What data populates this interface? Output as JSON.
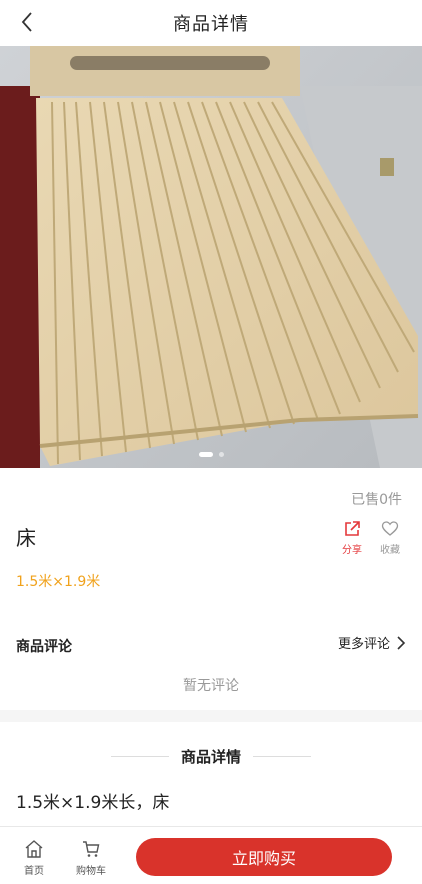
{
  "header": {
    "title": "商品详情",
    "back_icon": "chevron-left-icon"
  },
  "gallery": {
    "image_desc": "pine wood bed frame slats",
    "total_images": 2,
    "current_index": 1
  },
  "product": {
    "sold": "已售0件",
    "name": "床",
    "spec": "1.5米×1.9米",
    "spec_color": "#f0a21c"
  },
  "actions": {
    "share_label": "分享",
    "favorite_label": "收藏",
    "share_color": "#e4393c"
  },
  "reviews": {
    "title": "商品评论",
    "more_label": "更多评论",
    "empty_text": "暂无评论"
  },
  "details": {
    "title": "商品详情",
    "text": "1.5米×1.9米长，床"
  },
  "bottom_bar": {
    "home_label": "首页",
    "cart_label": "购物车",
    "buy_label": "立即购买",
    "buy_color": "#d9332b"
  }
}
